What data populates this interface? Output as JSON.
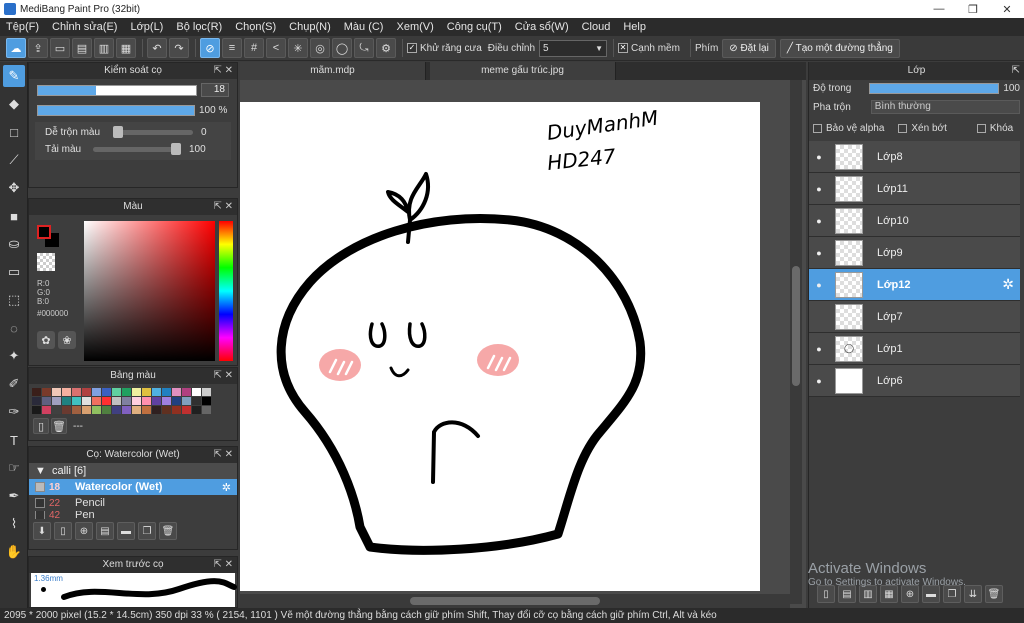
{
  "titlebar": {
    "title": "MediBang Paint Pro (32bit)",
    "minimize": "—",
    "maximize": "❐",
    "close": "✕"
  },
  "menu": [
    "Tệp(F)",
    "Chỉnh sửa(E)",
    "Lớp(L)",
    "Bộ lọc(R)",
    "Chọn(S)",
    "Chụp(N)",
    "Màu (C)",
    "Xem(V)",
    "Công cụ(T)",
    "Cửa sổ(W)",
    "Cloud",
    "Help"
  ],
  "toolbar": {
    "antialias_label": "Khử răng cưa",
    "adjust_label": "Điều chỉnh",
    "adjust_value": "5",
    "edge_label": "Cạnh mềm",
    "key_label": "Phím",
    "reset_label": "Đặt lại",
    "straight_line_label": "Tạo một đường thẳng"
  },
  "brush_control": {
    "title": "Kiểm soát cọ",
    "size_value": "18",
    "size_fraction": 0.37,
    "opacity_value": "100 %",
    "opacity_fraction": 1.0,
    "mix_label": "Dễ trộn màu",
    "mix_value": "0",
    "reload_label": "Tải màu",
    "reload_value": "100"
  },
  "color_panel": {
    "title": "Màu",
    "r": "R:0",
    "g": "G:0",
    "b": "B:0",
    "hex": "#000000",
    "fg_color": "#000000"
  },
  "palette": {
    "title": "Bảng màu",
    "name": "---",
    "colors": [
      "#3a1f1a",
      "#7a3a2a",
      "#f0c8b8",
      "#f4b0a0",
      "#d87070",
      "#b04040",
      "#80a0e0",
      "#3a60c0",
      "#60d0a0",
      "#20a060",
      "#f0f0a0",
      "#e0c040",
      "#50b0e0",
      "#2080c0",
      "#e090c0",
      "#b04080",
      "#fff",
      "#ccc",
      "#2a2a3a",
      "#606080",
      "#a0a0c0",
      "#208080",
      "#40c0c0",
      "#e0e0e0",
      "#f07060",
      "#ff3030",
      "#c0c0c0",
      "#8080a0",
      "#ffd0e0",
      "#ff90b0",
      "#6040a0",
      "#a080e0",
      "#204080",
      "#80a0c0",
      "#303030",
      "#000",
      "#1a1a1a",
      "#d04060",
      "#404040",
      "#6a3a30",
      "#a06040",
      "#d8a070",
      "#90c060",
      "#508040",
      "#404080",
      "#8060c0",
      "#e0b080",
      "#c07040",
      "#302020",
      "#603020",
      "#903020",
      "#c03030",
      "#202020",
      "#666"
    ]
  },
  "brush_panel": {
    "title": "Cọ: Watercolor (Wet)",
    "group": "calli [6]",
    "items": [
      {
        "num": "18",
        "name": "Watercolor (Wet)"
      },
      {
        "num": "22",
        "name": "Pencil"
      },
      {
        "num": "42",
        "name": "Pen"
      }
    ]
  },
  "preview": {
    "title": "Xem trước cọ",
    "size": "1.36mm"
  },
  "tabs": [
    "mãm.mdp",
    "meme gấu trúc.jpg"
  ],
  "canvas": {
    "signature_line1": "DuyManhM",
    "signature_line2": "HD247"
  },
  "layers_panel": {
    "title": "Lớp",
    "opacity_label": "Độ trong",
    "opacity_value": "100",
    "opacity_fraction": 1.0,
    "blend_label": "Pha trộn",
    "blend_value": "Bình thường",
    "protect_alpha": "Bảo vệ alpha",
    "clipping": "Xén bớt",
    "lock": "Khóa",
    "layers": [
      {
        "name": "Lớp8",
        "visible": true,
        "selected": false
      },
      {
        "name": "Lớp11",
        "visible": true,
        "selected": false
      },
      {
        "name": "Lớp10",
        "visible": true,
        "selected": false
      },
      {
        "name": "Lớp9",
        "visible": true,
        "selected": false
      },
      {
        "name": "Lớp12",
        "visible": true,
        "selected": true
      },
      {
        "name": "Lớp7",
        "visible": false,
        "selected": false
      },
      {
        "name": "Lớp1",
        "visible": true,
        "selected": false
      },
      {
        "name": "Lớp6",
        "visible": true,
        "selected": false
      }
    ]
  },
  "watermark": {
    "line1": "Activate Windows",
    "line2": "Go to Settings to activate Windows."
  },
  "status": "2095 * 2000 pixel   (15.2 * 14.5cm)   350 dpi   33 %   ( 2154, 1101 )   Vẽ một đường thẳng bằng cách giữ phím Shift, Thay đổi cỡ cọ bằng cách giữ phím Ctrl, Alt và kéo",
  "colors": {
    "accent": "#4f9de0",
    "panel": "#3d3d3d",
    "dark": "#2b2b2b"
  }
}
